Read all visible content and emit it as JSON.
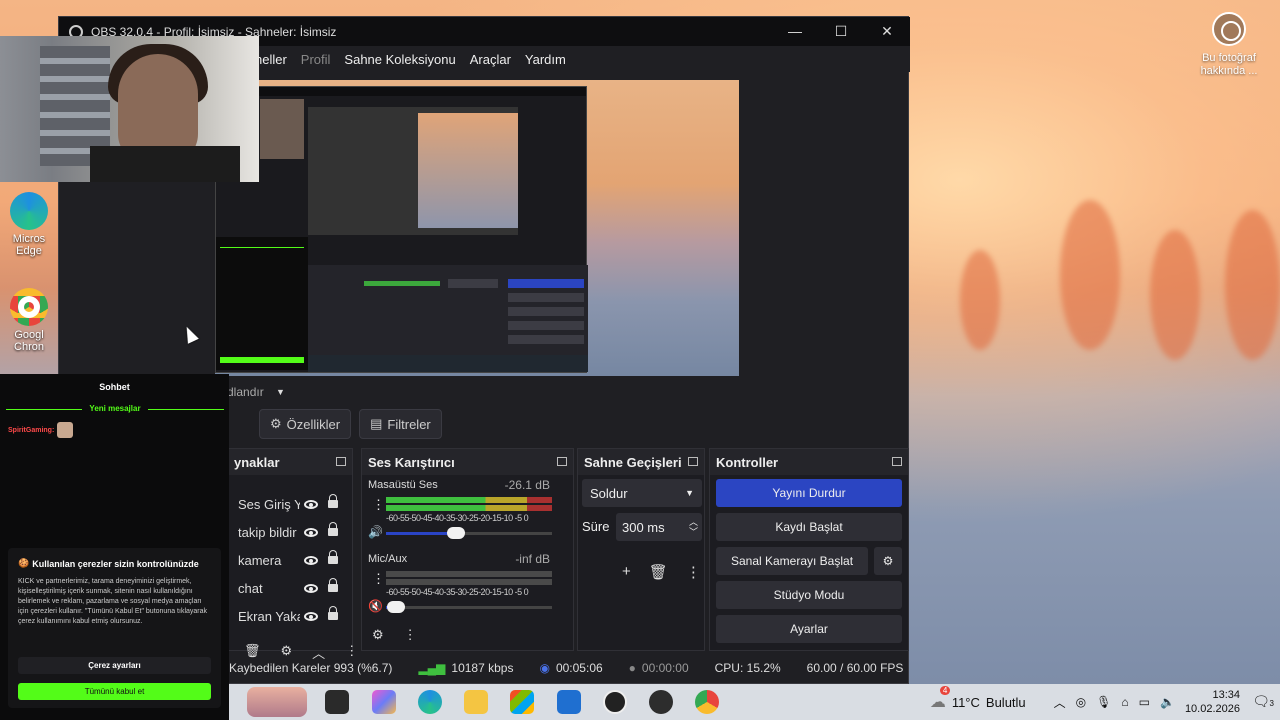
{
  "desktop": {
    "photo_info": "Bu fotoğraf hakkında ...",
    "icons": [
      {
        "label": "Micros Edge"
      },
      {
        "label": "Googl Chron"
      }
    ]
  },
  "obs": {
    "title": "OBS 32.0.4 - Profil: İsimsiz - Sahneler: İsimsiz",
    "window_controls": {
      "minimize": "—",
      "maximize": "☐",
      "close": "✕"
    },
    "menu": [
      "neller",
      "Profil",
      "Sahne Koleksiyonu",
      "Araçlar",
      "Yardım"
    ],
    "scene_label": "dlandır",
    "toolbar": {
      "properties": "Özellikler",
      "filters": "Filtreler"
    },
    "sources_dock": {
      "title": "ynaklar",
      "items": [
        "Ses Giriş Y",
        "takip bildir",
        "kamera",
        "chat",
        "Ekran Yaka"
      ]
    },
    "mixer_dock": {
      "title": "Ses Karıştırıcı",
      "channels": [
        {
          "name": "Masaüstü Ses",
          "db": "-26.1 dB",
          "volume_fraction": 0.42
        },
        {
          "name": "Mic/Aux",
          "db": "-inf dB",
          "volume_fraction": 0.06
        }
      ],
      "ticks": "-60-55-50-45-40-35-30-25-20-15-10 -5 0"
    },
    "transitions_dock": {
      "title": "Sahne Geçişleri",
      "transition": "Soldur",
      "duration_label": "Süre",
      "duration_value": "300 ms"
    },
    "controls_dock": {
      "title": "Kontroller",
      "stop_stream": "Yayını Durdur",
      "start_record": "Kaydı Başlat",
      "virtual_cam": "Sanal Kamerayı Başlat",
      "studio_mode": "Stüdyo Modu",
      "settings": "Ayarlar"
    },
    "status": {
      "dropped": "Kaybedilen Kareler 993 (%6.7)",
      "bitrate": "10187 kbps",
      "stream_time": "00:05:06",
      "record_time": "00:00:00",
      "cpu": "CPU: 15.2%",
      "fps": "60.00 / 60.00 FPS"
    }
  },
  "chat": {
    "header": "Sohbet",
    "new_messages": "Yeni mesajlar",
    "message_user": "SpiritGaming:",
    "cookie": {
      "title": "Kullanılan çerezler sizin kontrolünüzde",
      "body": "KICK ve partnerlerimiz, tarama deneyiminizi geliştirmek, kişiselleştirilmiş içerik sunmak, sitenin nasıl kullanıldığını belirlemek ve reklam, pazarlama ve sosyal medya amaçları için çerezleri kullanır. \"Tümünü Kabul Et\" butonuna tıklayarak çerez kullanımını kabul etmiş olursunuz.",
      "settings_button": "Çerez ayarları",
      "accept_button": "Tümünü kabul et"
    }
  },
  "taskbar": {
    "weather_temp": "11°C",
    "weather_desc": "Bulutlu",
    "weather_badge": "4",
    "time": "13:34",
    "date": "10.02.2026",
    "notif_count": "3"
  },
  "colors": {
    "accent_blue": "#2b45c2",
    "kick_green": "#53fc18",
    "obs_bg": "#1f1f23"
  }
}
